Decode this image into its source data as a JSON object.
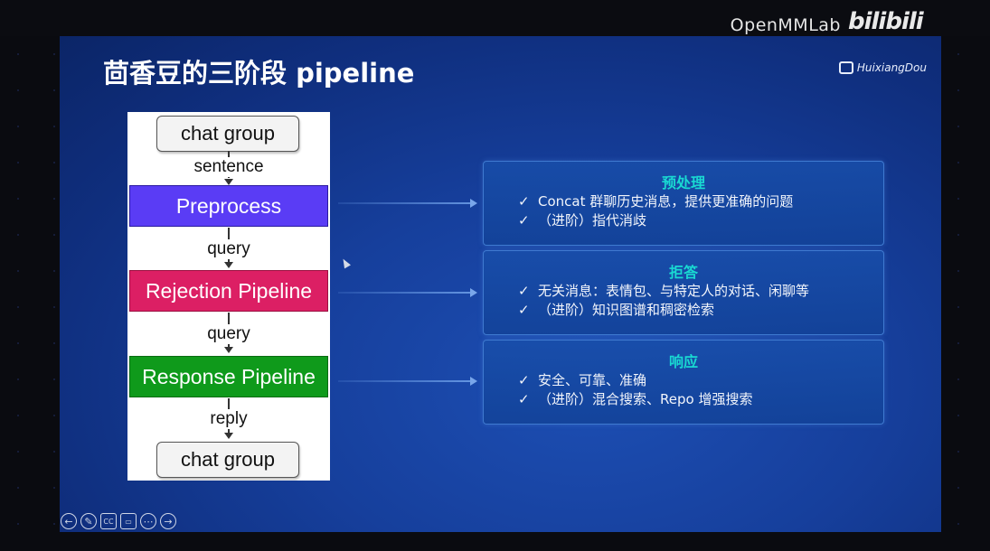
{
  "watermark": {
    "text": "OpenMMLab",
    "logo_text": "bilibili"
  },
  "slide": {
    "title": "茴香豆的三阶段 pipeline",
    "brand": "HuixiangDou"
  },
  "flow": {
    "top_chip": "chat group",
    "bottom_chip": "chat group",
    "edges": [
      "sentence",
      "query",
      "query",
      "reply"
    ],
    "stages": [
      {
        "label": "Preprocess",
        "color": "#5a3cf5"
      },
      {
        "label": "Rejection Pipeline",
        "color": "#dc1f64"
      },
      {
        "label": "Response Pipeline",
        "color": "#0f9a1b"
      }
    ]
  },
  "cards": [
    {
      "title": "预处理",
      "items": [
        "Concat 群聊历史消息，提供更准确的问题",
        "（进阶）指代消歧"
      ]
    },
    {
      "title": "拒答",
      "items": [
        "无关消息：表情包、与特定人的对话、闲聊等",
        "（进阶）知识图谱和稠密检索"
      ]
    },
    {
      "title": "响应",
      "items": [
        "安全、可靠、准确",
        "（进阶）混合搜索、Repo 增强搜索"
      ]
    }
  ],
  "check_glyph": "✓",
  "controls": [
    "back-icon",
    "pen-icon",
    "captions-icon",
    "video-off-icon",
    "more-icon",
    "forward-icon"
  ],
  "control_glyphs": [
    "←",
    "✎",
    "CC",
    "▭",
    "⋯",
    "→"
  ]
}
